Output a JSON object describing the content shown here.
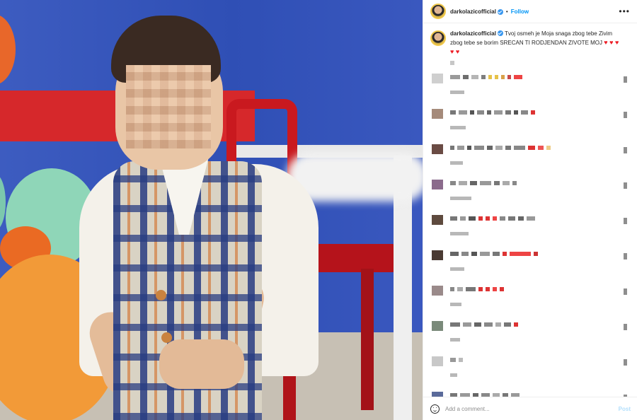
{
  "post": {
    "username": "darkolazicofficial",
    "verified": true,
    "separator": "•",
    "follow_label": "Follow",
    "more_label": "•••",
    "caption": "Tvoj osmeh je Moja snaga zbog tebe Zivim zbog tebe se borim SRECAN TI RODJENDAN ZIVOTE MOJ",
    "caption_hearts": "♥ ♥ ♥ ♥ ♥"
  },
  "comments": [
    {
      "avatar_color": "#cfcfcf",
      "blocks": [
        [
          "#9a9a9a",
          14
        ],
        [
          "#6e6e6e",
          8
        ],
        [
          "#b5b5b5",
          10
        ],
        [
          "#7e7e7e",
          6
        ],
        [
          "#e6c24a",
          5
        ],
        [
          "#e6c24a",
          5
        ],
        [
          "#d9a14a",
          5
        ],
        [
          "#c94a4a",
          5
        ],
        [
          "#e44",
          12
        ]
      ],
      "meta": [
        "#b8b8b8",
        20
      ]
    },
    {
      "avatar_color": "#a58a7a",
      "blocks": [
        [
          "#777",
          8
        ],
        [
          "#999",
          12
        ],
        [
          "#555",
          6
        ],
        [
          "#8a8a8a",
          10
        ],
        [
          "#666",
          6
        ],
        [
          "#999",
          12
        ],
        [
          "#777",
          8
        ],
        [
          "#555",
          6
        ],
        [
          "#888",
          10
        ],
        [
          "#d33",
          6
        ]
      ],
      "meta": [
        "#b8b8b8",
        22
      ]
    },
    {
      "avatar_color": "#6a4b44",
      "blocks": [
        [
          "#777",
          6
        ],
        [
          "#999",
          10
        ],
        [
          "#555",
          6
        ],
        [
          "#8a8a8a",
          14
        ],
        [
          "#666",
          8
        ],
        [
          "#aaa",
          10
        ],
        [
          "#777",
          8
        ],
        [
          "#888",
          16
        ],
        [
          "#d33",
          10
        ],
        [
          "#e55",
          8
        ],
        [
          "#ec8",
          6
        ]
      ],
      "meta": [
        "#b8b8b8",
        18
      ]
    },
    {
      "avatar_color": "#8b6b8c",
      "blocks": [
        [
          "#888",
          8
        ],
        [
          "#aaa",
          12
        ],
        [
          "#666",
          10
        ],
        [
          "#999",
          16
        ],
        [
          "#777",
          8
        ],
        [
          "#aaa",
          10
        ],
        [
          "#888",
          6
        ]
      ],
      "meta": [
        "#b8b8b8",
        30
      ]
    },
    {
      "avatar_color": "#5e4a3e",
      "blocks": [
        [
          "#777",
          10
        ],
        [
          "#999",
          8
        ],
        [
          "#555",
          10
        ],
        [
          "#d33",
          6
        ],
        [
          "#d33",
          6
        ],
        [
          "#e44",
          6
        ],
        [
          "#888",
          8
        ],
        [
          "#777",
          10
        ],
        [
          "#666",
          8
        ],
        [
          "#999",
          12
        ]
      ],
      "meta": [
        "#b8b8b8",
        26
      ]
    },
    {
      "avatar_color": "#4a3a32",
      "blocks": [
        [
          "#666",
          12
        ],
        [
          "#888",
          10
        ],
        [
          "#555",
          8
        ],
        [
          "#999",
          14
        ],
        [
          "#777",
          10
        ],
        [
          "#d33",
          6
        ],
        [
          "#e44",
          30
        ],
        [
          "#c33",
          6
        ]
      ],
      "meta": [
        "#b8b8b8",
        20
      ]
    },
    {
      "avatar_color": "#9a8a8a",
      "blocks": [
        [
          "#888",
          6
        ],
        [
          "#aaa",
          8
        ],
        [
          "#777",
          14
        ],
        [
          "#d33",
          6
        ],
        [
          "#d33",
          6
        ],
        [
          "#e44",
          6
        ],
        [
          "#d33",
          6
        ]
      ],
      "meta": [
        "#b8b8b8",
        16
      ]
    },
    {
      "avatar_color": "#7a8a7a",
      "blocks": [
        [
          "#777",
          14
        ],
        [
          "#999",
          12
        ],
        [
          "#666",
          10
        ],
        [
          "#888",
          12
        ],
        [
          "#aaa",
          8
        ],
        [
          "#777",
          10
        ],
        [
          "#d33",
          6
        ]
      ],
      "meta": [
        "#b8b8b8",
        14
      ]
    },
    {
      "avatar_color": "#c8c8c8",
      "blocks": [
        [
          "#999",
          8
        ],
        [
          "#bbb",
          6
        ]
      ],
      "meta": [
        "#b8b8b8",
        10
      ]
    },
    {
      "avatar_color": "#5a6a9a",
      "blocks": [
        [
          "#777",
          10
        ],
        [
          "#999",
          14
        ],
        [
          "#666",
          8
        ],
        [
          "#888",
          12
        ],
        [
          "#aaa",
          10
        ],
        [
          "#777",
          8
        ],
        [
          "#999",
          12
        ]
      ],
      "meta": [
        "#b8b8b8",
        12
      ]
    }
  ],
  "footer": {
    "placeholder": "Add a comment...",
    "post_label": "Post"
  }
}
